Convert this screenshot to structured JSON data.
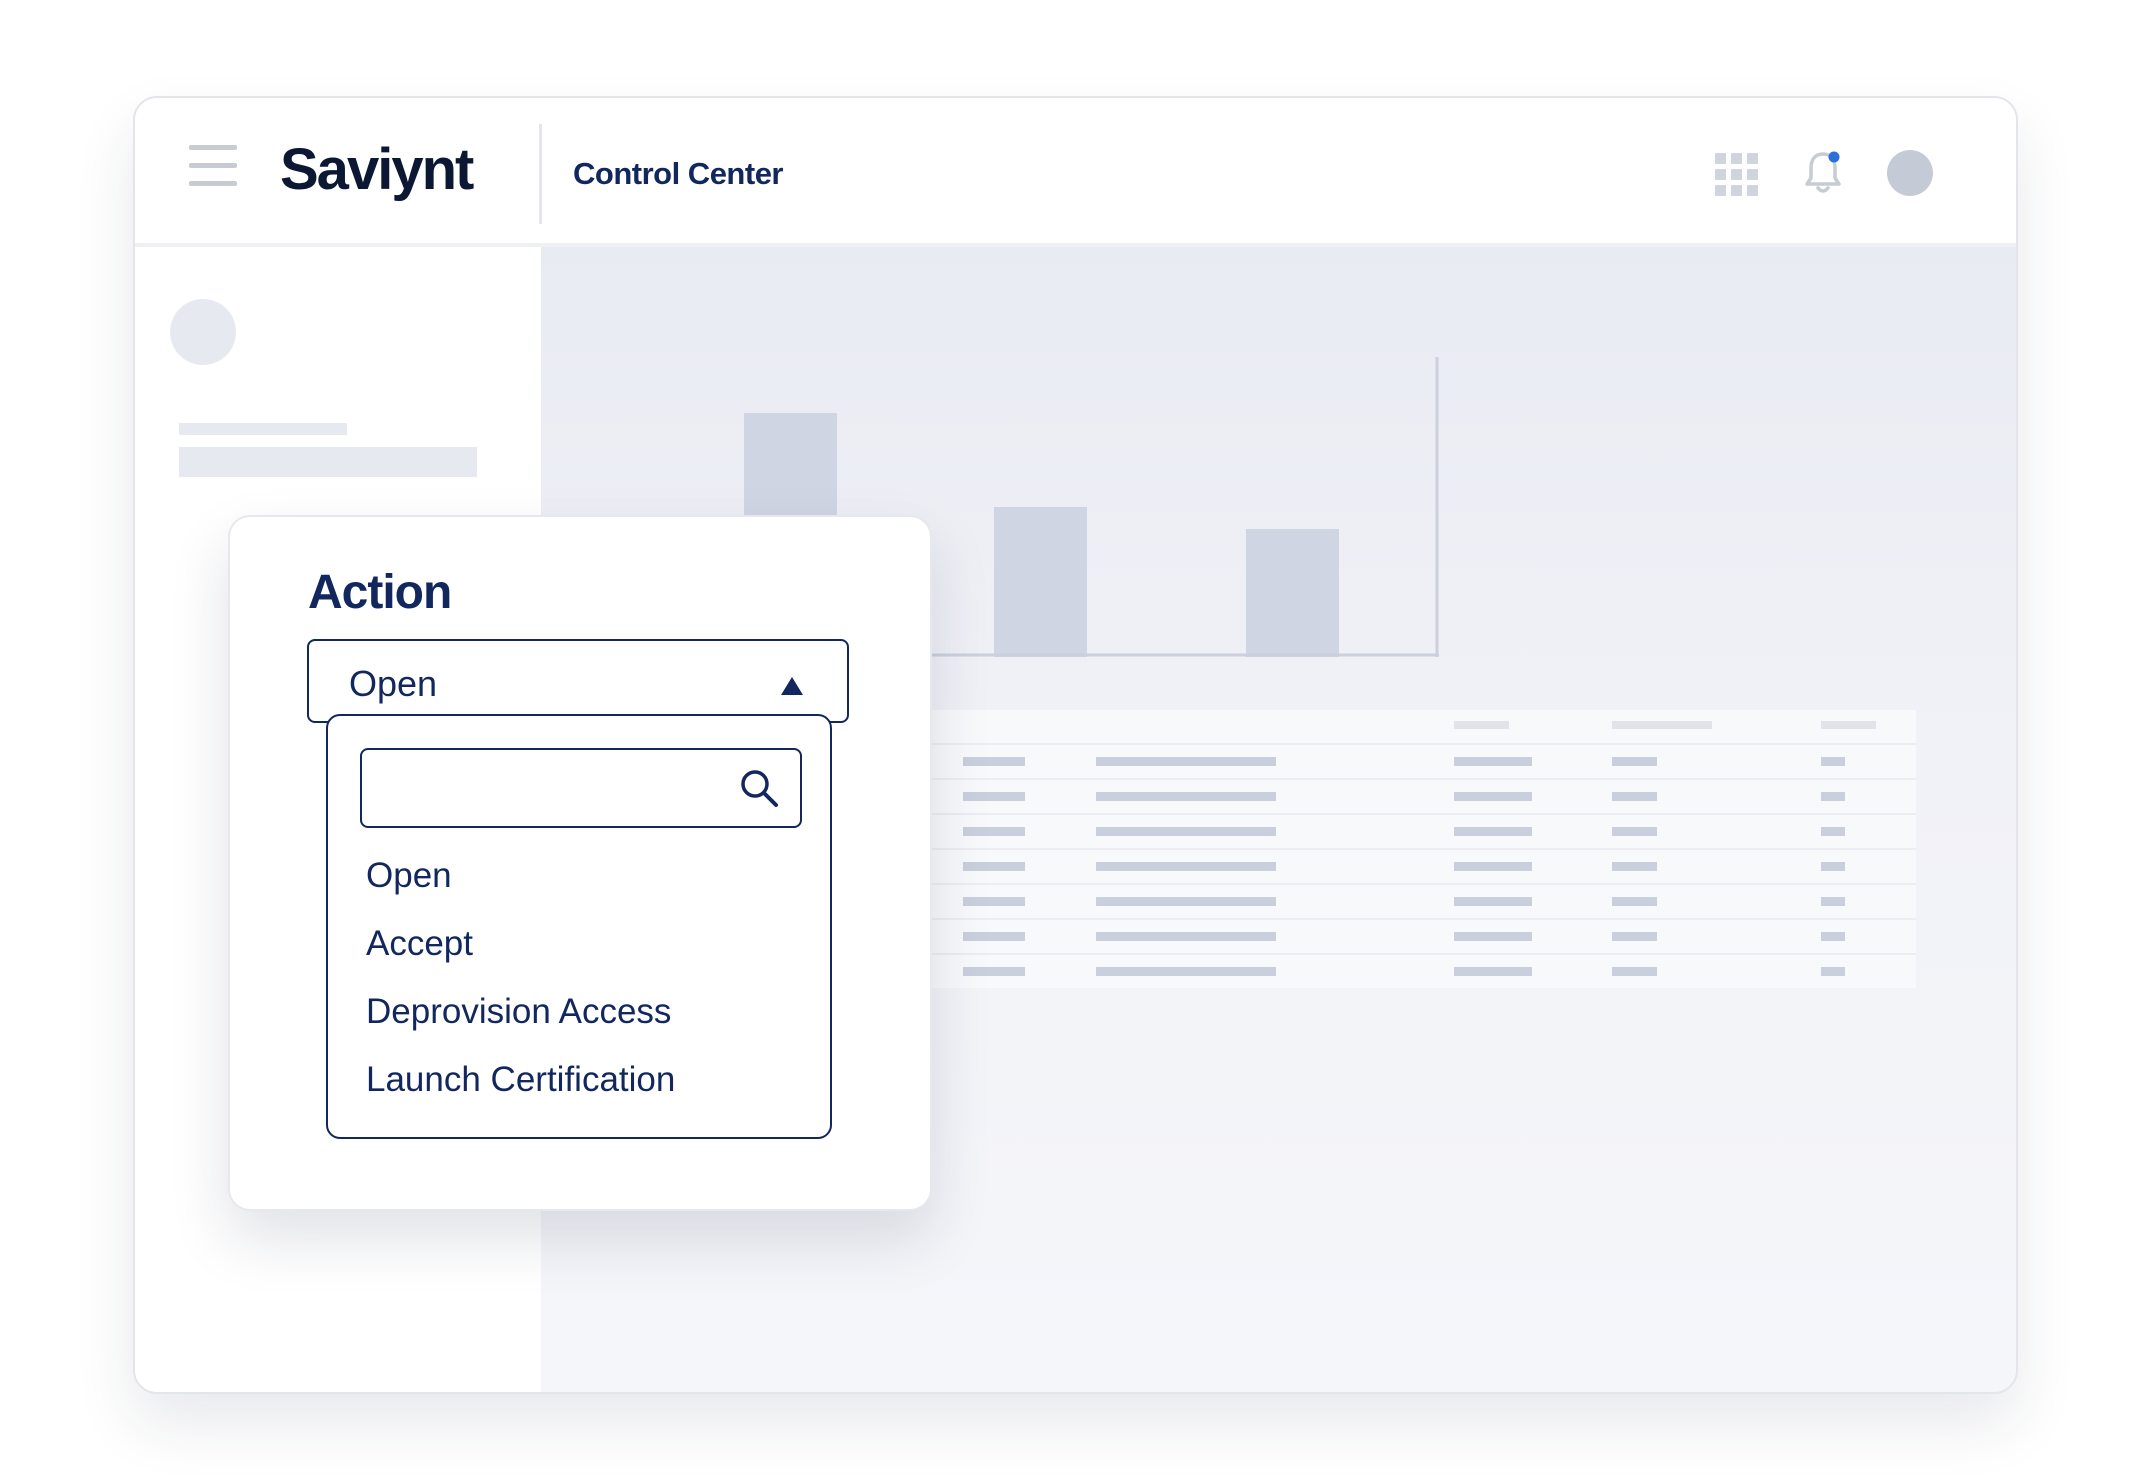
{
  "header": {
    "logo_text": "Saviynt",
    "app_title": "Control Center",
    "icons": [
      "menu-icon",
      "apps-grid-icon",
      "notification-bell-icon",
      "user-avatar"
    ],
    "notification_dot_color": "#2a6fdb"
  },
  "action_panel": {
    "title": "Action",
    "selected_value": "Open",
    "search": {
      "value": "",
      "placeholder": ""
    },
    "options": [
      {
        "label": "Open"
      },
      {
        "label": "Accept"
      },
      {
        "label": "Deprovision Access"
      },
      {
        "label": "Launch Certification"
      }
    ]
  },
  "colors": {
    "primary_navy": "#11275e",
    "logo": "#0c1733",
    "placeholder": "#c9cfdd",
    "background": "#eef0f6"
  }
}
